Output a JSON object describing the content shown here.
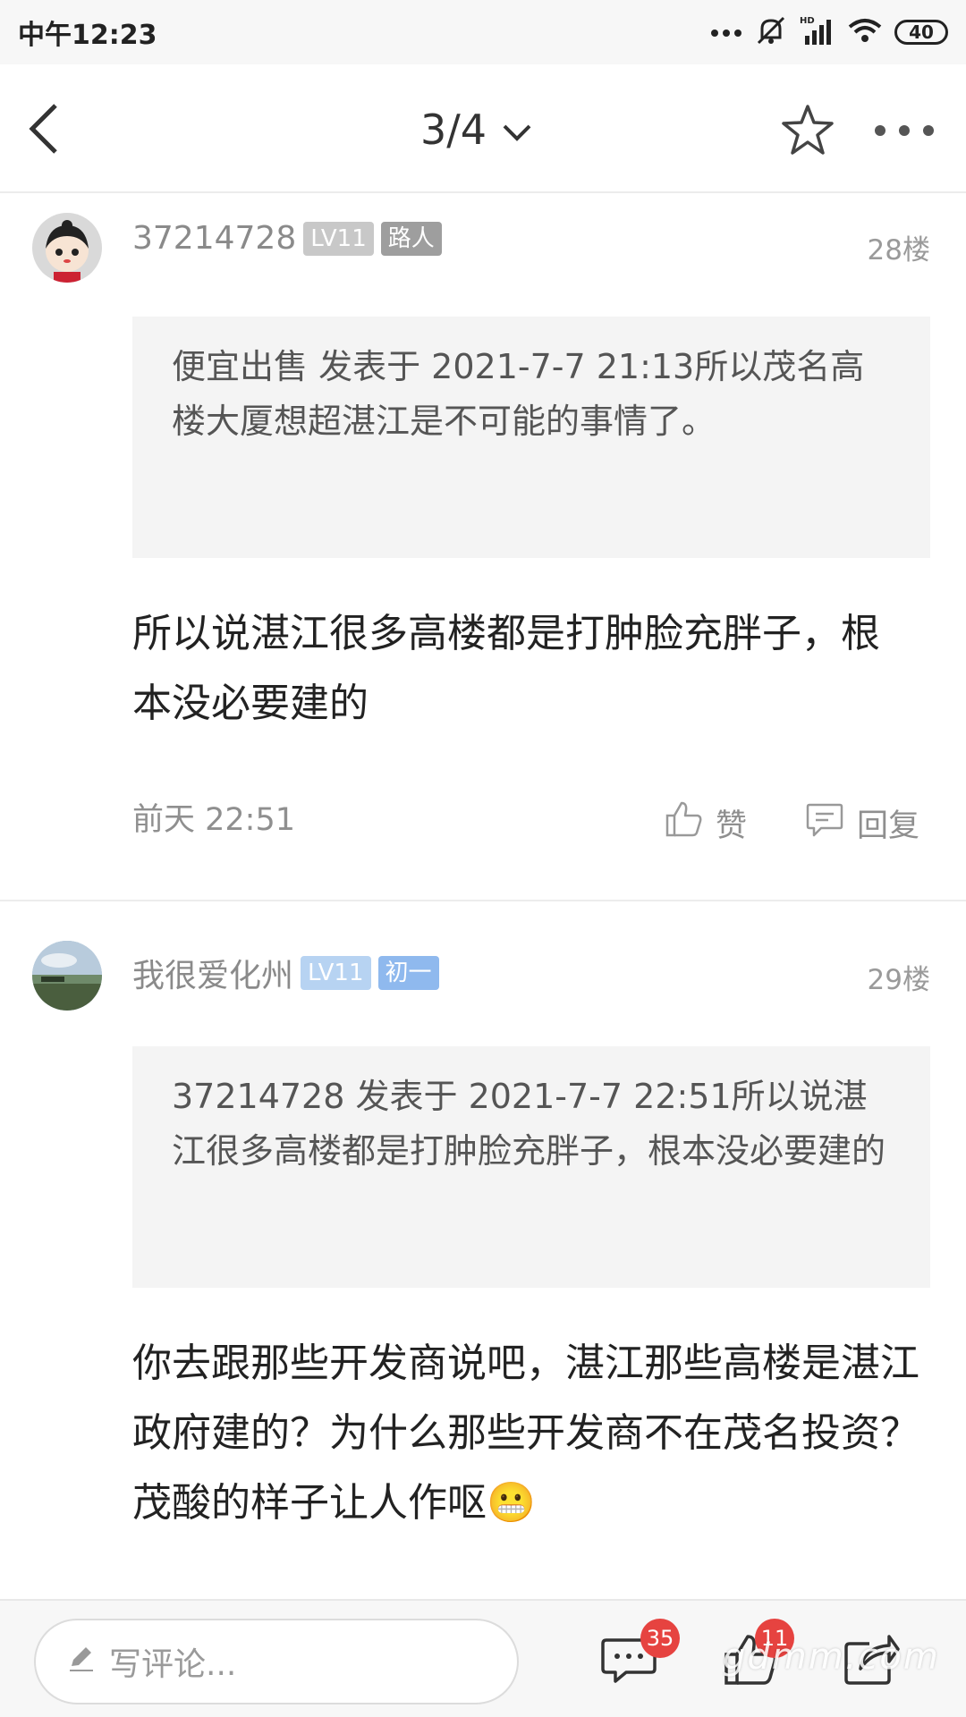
{
  "status_bar": {
    "time": "中午12:23",
    "battery": "40",
    "icons": [
      "more-dots-icon",
      "mute-icon",
      "hd-signal-icon",
      "wifi-icon",
      "battery-icon"
    ]
  },
  "nav": {
    "page_indicator": "3/4",
    "icons": [
      "back-icon",
      "chevron-down-icon",
      "star-icon",
      "more-icon"
    ]
  },
  "posts": [
    {
      "username": "37214728",
      "level": "LV11",
      "title_badge": "路人",
      "badge_color": "#9e9e9e",
      "floor": "28楼",
      "quote": "便宜出售 发表于 2021-7-7 21:13所以茂名高楼大厦想超湛江是不可能的事情了。",
      "content": "所以说湛江很多高楼都是打肿脸充胖子，根本没必要建的",
      "time": "前天 22:51",
      "like_label": "赞",
      "reply_label": "回复"
    },
    {
      "username": "我很爱化州",
      "level": "LV11",
      "title_badge": "初一",
      "badge_color": "#8fb9ee",
      "floor": "29楼",
      "quote": "37214728 发表于 2021-7-7 22:51所以说湛江很多高楼都是打肿脸充胖子，根本没必要建的",
      "content": "你去跟那些开发商说吧，湛江那些高楼是湛江政府建的？为什么那些开发商不在茂名投资？茂酸的样子让人作呕😬"
    }
  ],
  "bottom_bar": {
    "comment_placeholder": "写评论...",
    "comment_count": "35",
    "like_count": "11"
  },
  "watermark": "gdmm.com"
}
